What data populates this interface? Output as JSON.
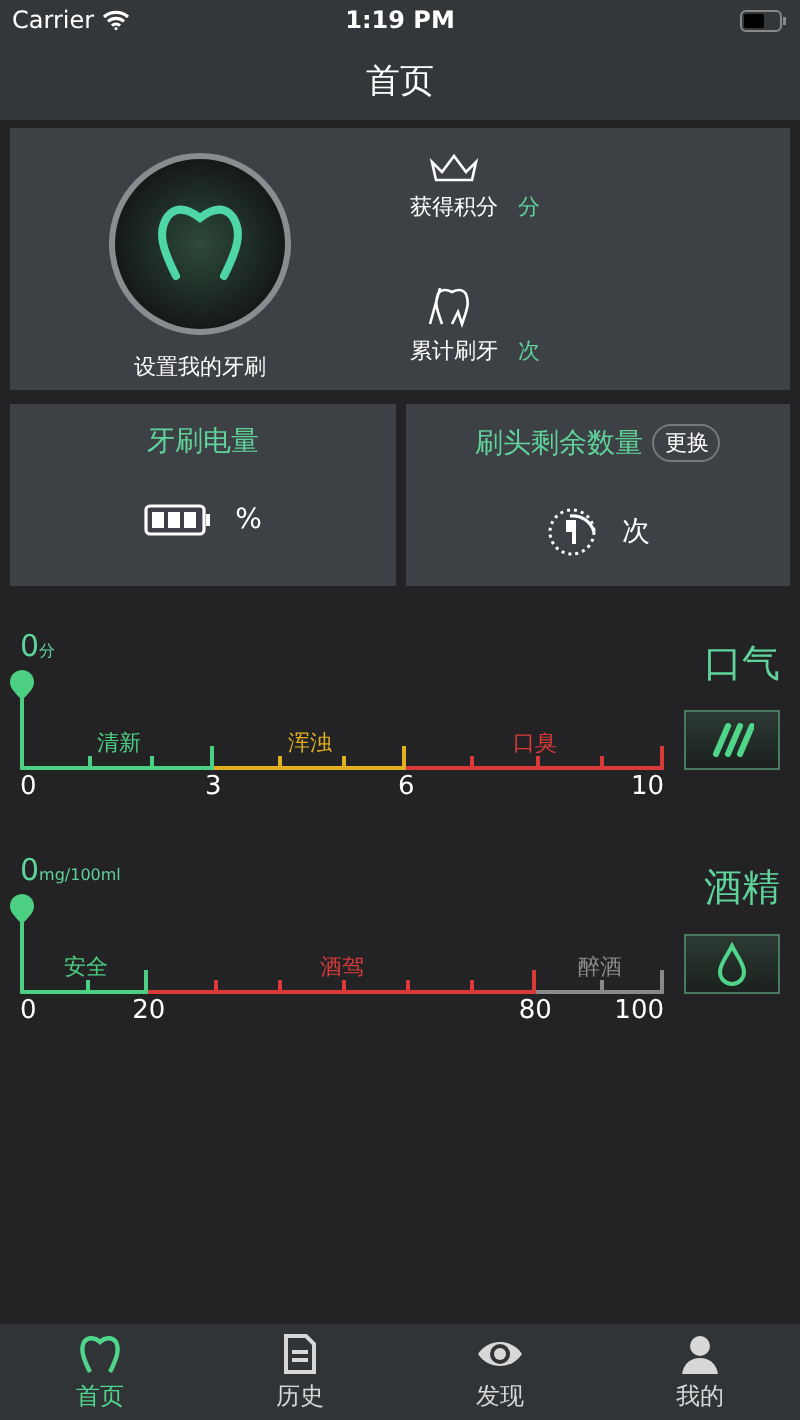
{
  "status_bar": {
    "carrier": "Carrier",
    "time": "1:19 PM"
  },
  "nav": {
    "title": "首页"
  },
  "device": {
    "label": "设置我的牙刷",
    "stats": [
      {
        "kind": "points",
        "label": "获得积分",
        "unit": "分"
      },
      {
        "kind": "brushings",
        "label": "累计刷牙",
        "unit": "次"
      }
    ]
  },
  "battery_card": {
    "title": "牙刷电量",
    "unit": "%"
  },
  "brush_head_card": {
    "title": "刷头剩余数量",
    "button": "更换",
    "unit": "次"
  },
  "gauges": [
    {
      "kind": "breath",
      "value": "0",
      "unit": "分",
      "title": "口气",
      "zones": [
        {
          "label": "清新",
          "color": "#4ccf83"
        },
        {
          "label": "浑浊",
          "color": "#e0b020"
        },
        {
          "label": "口臭",
          "color": "#d83a3a"
        }
      ],
      "ticks": [
        "0",
        "3",
        "6",
        "10"
      ]
    },
    {
      "kind": "alcohol",
      "value": "0",
      "unit": "mg/100ml",
      "title": "酒精",
      "zones": [
        {
          "label": "安全",
          "color": "#4ccf83"
        },
        {
          "label": "酒驾",
          "color": "#d83a3a"
        },
        {
          "label": "醉酒",
          "color": "#8a8a8a"
        }
      ],
      "ticks": [
        "0",
        "20",
        "80",
        "100"
      ]
    }
  ],
  "tabs": [
    {
      "kind": "home",
      "label": "首页",
      "selected": true
    },
    {
      "kind": "history",
      "label": "历史",
      "selected": false
    },
    {
      "kind": "discover",
      "label": "发现",
      "selected": false
    },
    {
      "kind": "profile",
      "label": "我的",
      "selected": false
    }
  ]
}
